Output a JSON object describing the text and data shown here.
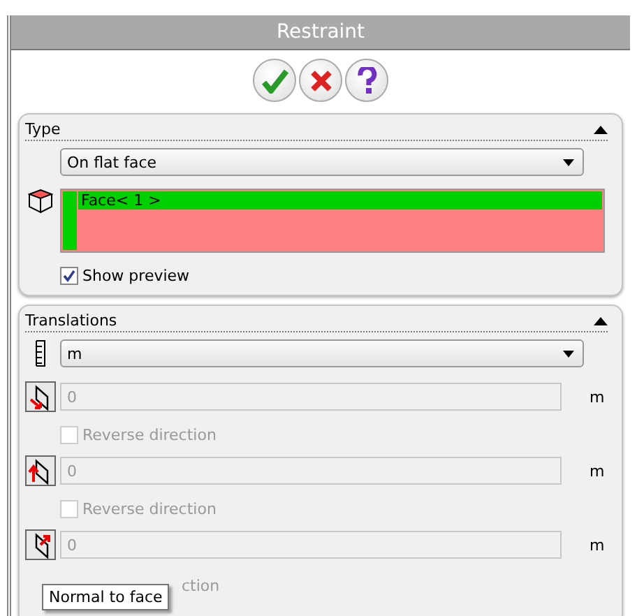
{
  "window": {
    "title": "Restraint"
  },
  "actions": [
    {
      "kind": "ok"
    },
    {
      "kind": "cancel"
    },
    {
      "kind": "help"
    }
  ],
  "type_group": {
    "title": "Type",
    "expanded": true,
    "dropdown": {
      "value": "On flat face"
    },
    "selection": {
      "items": [
        {
          "label": "Face< 1 >",
          "selected": true
        }
      ]
    },
    "show_preview": {
      "label": "Show preview",
      "checked": true
    }
  },
  "translations_group": {
    "title": "Translations",
    "expanded": true,
    "unit_dropdown": {
      "value": "m"
    },
    "rows": [
      {
        "kind": "along",
        "value": "0",
        "unit": "m",
        "disabled": true,
        "reverse": {
          "label": "Reverse direction",
          "checked": false,
          "disabled": true
        }
      },
      {
        "kind": "across",
        "value": "0",
        "unit": "m",
        "disabled": true,
        "reverse": {
          "label": "Reverse direction",
          "checked": false,
          "disabled": true
        }
      },
      {
        "kind": "normal",
        "value": "0",
        "unit": "m",
        "disabled": true,
        "reverse": {
          "label": "ction",
          "disabled": true,
          "covered": true
        }
      }
    ]
  },
  "tooltip": {
    "text": "Normal to face"
  }
}
